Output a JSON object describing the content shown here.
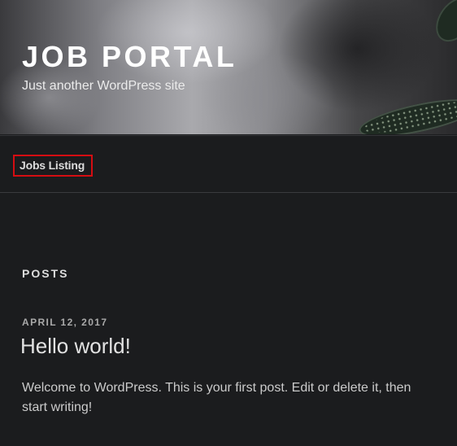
{
  "site": {
    "title": "JOB PORTAL",
    "tagline": "Just another WordPress site"
  },
  "nav": {
    "items": [
      {
        "label": "Jobs Listing"
      }
    ]
  },
  "main": {
    "section_title": "POSTS",
    "posts": [
      {
        "date": "APRIL 12, 2017",
        "title": "Hello world!",
        "excerpt": "Welcome to WordPress. This is your first post. Edit or delete it, then start writing!"
      }
    ]
  },
  "colors": {
    "background": "#1b1c1e",
    "focus_outline": "#d50d12",
    "title_text": "#ffffff"
  }
}
